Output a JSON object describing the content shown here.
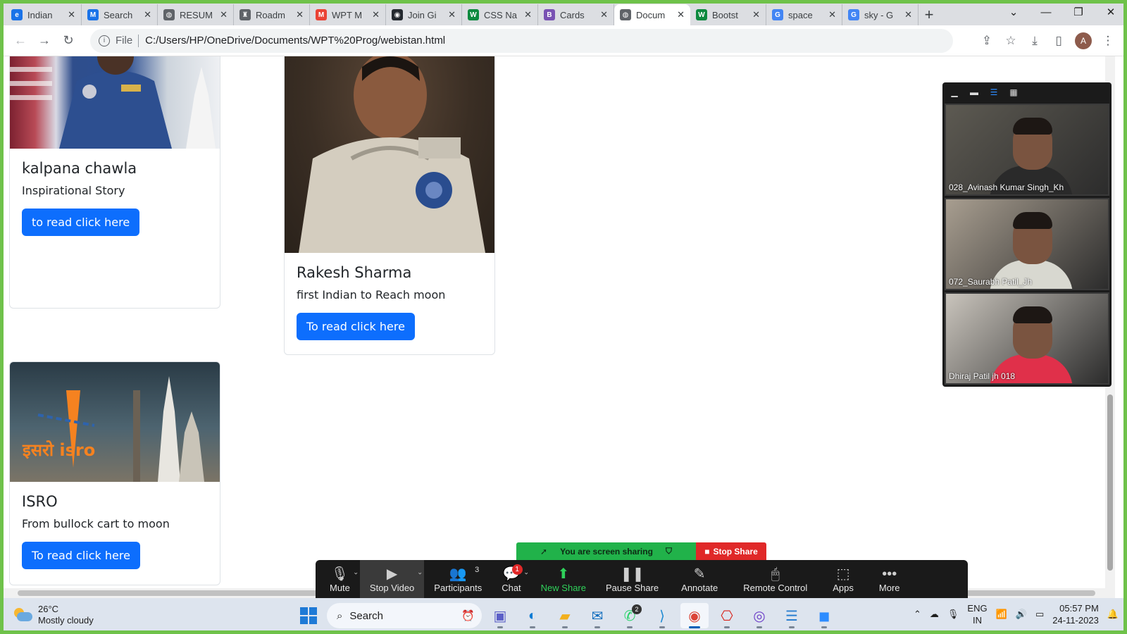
{
  "browser": {
    "tabs": [
      {
        "title": "Indian",
        "favicon_color": "#1a73e8",
        "glyph": "e",
        "active": false
      },
      {
        "title": "Search",
        "favicon_color": "#1a73e8",
        "glyph": "M",
        "active": false
      },
      {
        "title": "RESUM",
        "favicon_color": "#5f6368",
        "glyph": "◍",
        "active": false
      },
      {
        "title": "Roadm",
        "favicon_color": "#5f6368",
        "glyph": "♜",
        "active": false
      },
      {
        "title": "WPT M",
        "favicon_color": "#ea4335",
        "glyph": "M",
        "active": false
      },
      {
        "title": "Join Gi",
        "favicon_color": "#24292f",
        "glyph": "◉",
        "active": false
      },
      {
        "title": "CSS Na",
        "favicon_color": "#0d8a3f",
        "glyph": "W",
        "active": false
      },
      {
        "title": "Cards",
        "favicon_color": "#7952b3",
        "glyph": "B",
        "active": false
      },
      {
        "title": "Docum",
        "favicon_color": "#5f6368",
        "glyph": "◍",
        "active": true
      },
      {
        "title": "Bootst",
        "favicon_color": "#0d8a3f",
        "glyph": "W",
        "active": false
      },
      {
        "title": "space",
        "favicon_color": "#4285f4",
        "glyph": "G",
        "active": false
      },
      {
        "title": "sky - G",
        "favicon_color": "#4285f4",
        "glyph": "G",
        "active": false
      }
    ],
    "close_glyph": "✕",
    "new_tab": "+",
    "window_controls": {
      "dropdown": "⌄",
      "minimize": "—",
      "maximize": "❐",
      "close": "✕"
    },
    "nav": {
      "back": "←",
      "forward": "→",
      "reload": "↻"
    },
    "address": {
      "info": "i",
      "scheme_label": "File",
      "url": "C:/Users/HP/OneDrive/Documents/WPT%20Prog/webistan.html"
    },
    "toolbar_icons": {
      "share": "⇪",
      "bookmark": "☆",
      "download": "⤓",
      "sidepanel": "▯",
      "profile": "A",
      "menu": "⋮"
    }
  },
  "page": {
    "cards": [
      {
        "id": "kalpana",
        "title": "kalpana chawla",
        "text": "Inspirational Story",
        "button": "to read click here"
      },
      {
        "id": "rakesh",
        "title": "Rakesh Sharma",
        "text": "first Indian to Reach moon",
        "button": "To read click here"
      },
      {
        "id": "isro",
        "title": "ISRO",
        "text": "From bullock cart to moon",
        "button": "To read click here"
      }
    ],
    "isro_logo_text": "इसरो isro"
  },
  "zoom": {
    "panel_icons": {
      "minimize": "▁",
      "speaker": "▬",
      "strip": "☰",
      "gallery": "▦"
    },
    "participants_video": [
      {
        "name": "028_Avinash Kumar Singh_Kh",
        "bg": "#5d5a52",
        "shirt": "#2a2a2a"
      },
      {
        "name": "072_Saurabh Patil_Jh",
        "bg": "#a89e90",
        "shirt": "#d8d8d0"
      },
      {
        "name": "Dhiraj Patil jh 018",
        "bg": "#c9c4bc",
        "shirt": "#e0304a"
      }
    ],
    "banner": {
      "text": "You are screen sharing",
      "stop": "Stop Share"
    },
    "toolbar": [
      {
        "label": "Mute",
        "icon": "🎙",
        "caret": "⌃"
      },
      {
        "label": "Stop Video",
        "icon": "▶",
        "caret": "⌃"
      },
      {
        "label": "Participants",
        "icon": "👥",
        "count": "3"
      },
      {
        "label": "Chat",
        "icon": "💬",
        "badge": "1",
        "caret": "⌃"
      },
      {
        "label": "New Share",
        "icon": "⬆"
      },
      {
        "label": "Pause Share",
        "icon": "❚❚"
      },
      {
        "label": "Annotate",
        "icon": "✎"
      },
      {
        "label": "Remote Control",
        "icon": "🖱"
      },
      {
        "label": "Apps",
        "icon": "⬚"
      },
      {
        "label": "More",
        "icon": "•••"
      }
    ]
  },
  "taskbar": {
    "weather": {
      "temp": "26°C",
      "condition": "Mostly cloudy"
    },
    "search_label": "Search",
    "apps": [
      {
        "name": "teams-icon",
        "glyph": "▣",
        "color": "#5b5fc7"
      },
      {
        "name": "edge-icon",
        "glyph": "◐",
        "color": "#0c7bd4"
      },
      {
        "name": "file-explorer-icon",
        "glyph": "▰",
        "color": "#f2b01e"
      },
      {
        "name": "mail-icon",
        "glyph": "✉",
        "color": "#0f6cbd"
      },
      {
        "name": "whatsapp-icon",
        "glyph": "✆",
        "color": "#25d366",
        "badge": "2"
      },
      {
        "name": "vscode-icon",
        "glyph": "⟩",
        "color": "#1f8ad2"
      },
      {
        "name": "chrome-icon",
        "glyph": "◉",
        "color": "#db4437",
        "active": true
      },
      {
        "name": "acrobat-icon",
        "glyph": "⎔",
        "color": "#d9241c"
      },
      {
        "name": "github-desktop-icon",
        "glyph": "◎",
        "color": "#6e40c9"
      },
      {
        "name": "notepad-icon",
        "glyph": "☰",
        "color": "#2b7fd1"
      },
      {
        "name": "zoom-icon",
        "glyph": "◼",
        "color": "#2d8cff"
      }
    ],
    "tray": {
      "chevron": "⌃",
      "lang1": "ENG",
      "lang2": "IN",
      "time": "05:57 PM",
      "date": "24-11-2023"
    }
  }
}
